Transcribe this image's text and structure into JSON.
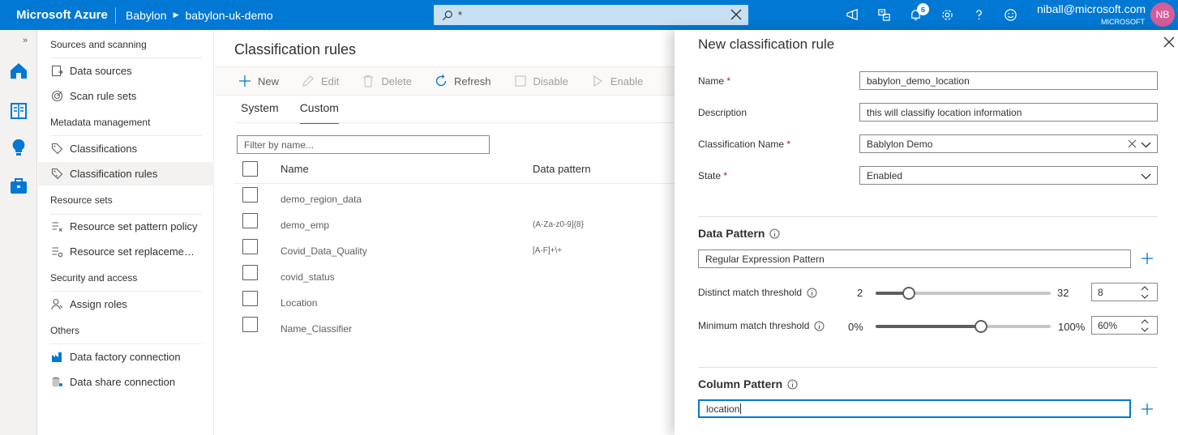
{
  "topbar": {
    "brand": "Microsoft Azure",
    "breadcrumbs": [
      "Babylon",
      "babylon-uk-demo"
    ],
    "search": {
      "value": "*"
    },
    "icons": [
      "feedback-icon",
      "directory-icon",
      "notifications-icon",
      "settings-icon",
      "help-icon",
      "smiley-icon"
    ],
    "notifications_count": "6",
    "account": {
      "email": "niball@microsoft.com",
      "tenant": "MICROSOFT",
      "initials": "NB"
    },
    "colors": {
      "bar": "#0078d4",
      "search_bg": "#c7e0f4",
      "avatar": "#d65c9a"
    }
  },
  "rail": {
    "expand_glyph": "»",
    "icons": [
      "home-icon",
      "catalog-icon",
      "insights-icon",
      "management-icon"
    ]
  },
  "nav": {
    "sections": [
      {
        "heading": "Sources and scanning",
        "items": [
          {
            "label": "Data sources",
            "icon": "data-sources-icon"
          },
          {
            "label": "Scan rule sets",
            "icon": "scan-rule-sets-icon"
          }
        ]
      },
      {
        "heading": "Metadata management",
        "items": [
          {
            "label": "Classifications",
            "icon": "classifications-icon"
          },
          {
            "label": "Classification rules",
            "icon": "classification-rules-icon",
            "active": true
          }
        ]
      },
      {
        "heading": "Resource sets",
        "items": [
          {
            "label": "Resource set pattern policy",
            "icon": "pattern-policy-icon"
          },
          {
            "label": "Resource set replacement ...",
            "icon": "replacement-icon"
          }
        ]
      },
      {
        "heading": "Security and access",
        "items": [
          {
            "label": "Assign roles",
            "icon": "assign-roles-icon"
          }
        ]
      },
      {
        "heading": "Others",
        "items": [
          {
            "label": "Data factory connection",
            "icon": "data-factory-icon"
          },
          {
            "label": "Data share connection",
            "icon": "data-share-icon"
          }
        ]
      }
    ]
  },
  "main": {
    "title": "Classification rules",
    "commands": {
      "new": "New",
      "edit": "Edit",
      "delete": "Delete",
      "refresh": "Refresh",
      "disable": "Disable",
      "enable": "Enable"
    },
    "tabs": {
      "system": "System",
      "custom": "Custom",
      "active": "Custom"
    },
    "filter_placeholder": "Filter by name...",
    "columns": {
      "name": "Name",
      "pattern": "Data pattern"
    },
    "rows": [
      {
        "name": "demo_region_data",
        "pattern": ""
      },
      {
        "name": "demo_emp",
        "pattern": "(A-Za-z0-9]{8}"
      },
      {
        "name": "Covid_Data_Quality",
        "pattern": "[A-F]+\\+"
      },
      {
        "name": "covid_status",
        "pattern": ""
      },
      {
        "name": "Location",
        "pattern": ""
      },
      {
        "name": "Name_Classifier",
        "pattern": ""
      }
    ]
  },
  "flyout": {
    "title": "New classification rule",
    "fields": {
      "name": {
        "label": "Name",
        "required_mark": "*",
        "value": "babylon_demo_location"
      },
      "description": {
        "label": "Description",
        "value": "this will classifiy location information"
      },
      "classification_name": {
        "label": "Classification Name",
        "required_mark": "*",
        "value": "Bablylon Demo"
      },
      "state": {
        "label": "State",
        "required_mark": "*",
        "value": "Enabled"
      }
    },
    "data_pattern": {
      "title": "Data Pattern",
      "value": "Regular Expression Pattern",
      "distinct": {
        "label": "Distinct match threshold",
        "min": "2",
        "max": "32",
        "value": "8",
        "fraction": 0.1875
      },
      "minimum": {
        "label": "Minimum match threshold",
        "min": "0%",
        "max": "100%",
        "value": "60%",
        "fraction": 0.6
      }
    },
    "column_pattern": {
      "title": "Column Pattern",
      "value": "location"
    }
  }
}
